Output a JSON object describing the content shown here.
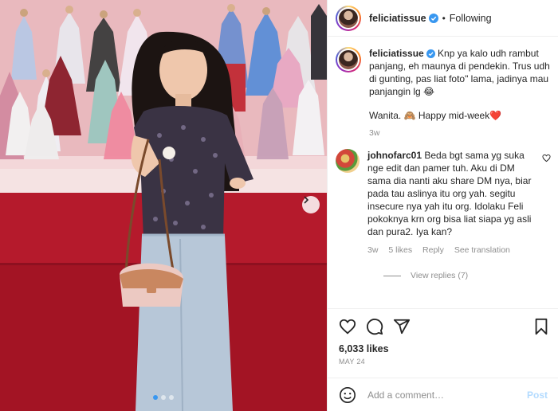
{
  "post": {
    "author": "feliciatissue",
    "follow_state": "Following",
    "separator": "•"
  },
  "caption": {
    "username": "feliciatissue",
    "text": " Knp ya kalo udh rambut panjang, eh maunya di pendekin. Trus udh di gunting, pas liat foto\" lama, jadinya mau panjangin lg 😂",
    "text2": "Wanita. 🙈 Happy mid-week❤️",
    "time": "3w"
  },
  "comments": [
    {
      "username": "johnofarc01",
      "text": " Beda bgt sama yg suka nge edit dan pamer tuh. Aku di DM sama dia nanti aku share DM nya, biar pada tau aslinya itu org yah. segitu insecure nya yah itu org. Idolaku Feli pokoknya krn org bisa liat siapa yg asli dan pura2. Iya kan?",
      "time": "3w",
      "likes": "5 likes",
      "reply": "Reply",
      "translate": "See translation",
      "view_replies": "View replies (7)"
    }
  ],
  "stats": {
    "likes": "6,033 likes",
    "date": "MAY 24"
  },
  "composer": {
    "placeholder": "Add a comment…",
    "post_label": "Post"
  },
  "carousel": {
    "slides": 3,
    "active_index": 0
  },
  "colors": {
    "verified": "#3897f0",
    "accent_blue": "#3897f0",
    "heart_red": "#ed4956",
    "post_disabled": "#b3dbff"
  },
  "icons": [
    "heart-icon",
    "comment-icon",
    "share-icon",
    "bookmark-icon",
    "emoji-icon",
    "chevron-right-icon",
    "verified-icon"
  ]
}
